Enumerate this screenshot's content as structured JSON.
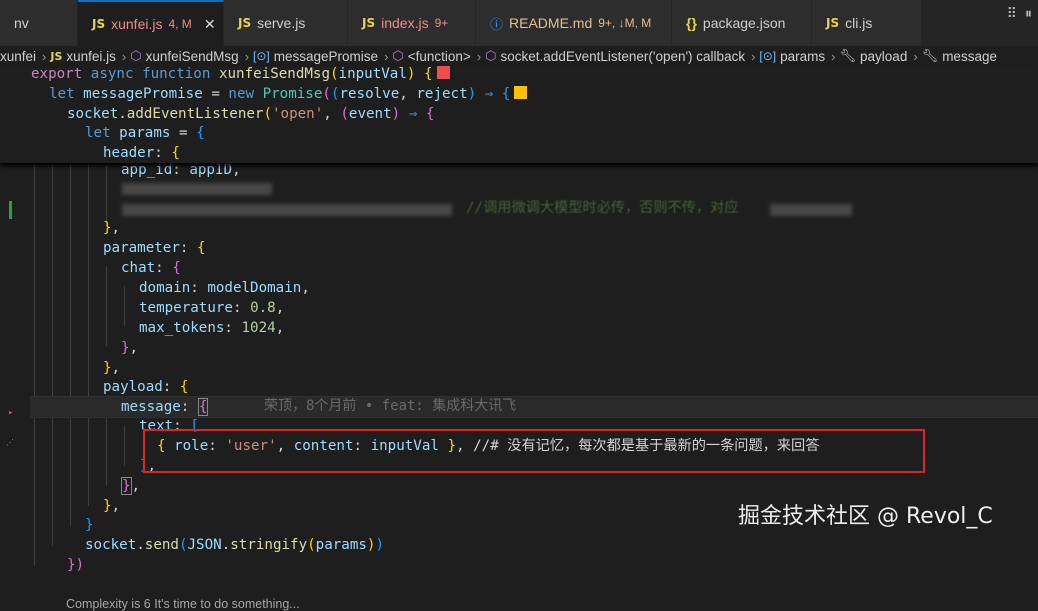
{
  "tabs": [
    {
      "icon": "",
      "label": "nv",
      "badge": "",
      "active": false
    },
    {
      "icon": "JS",
      "label": "xunfei.js",
      "badge": "4, M",
      "active": true
    },
    {
      "icon": "JS",
      "label": "serve.js",
      "badge": "",
      "active": false
    },
    {
      "icon": "JS",
      "label": "index.js",
      "badge": "9+",
      "active": false
    },
    {
      "icon": "ⓘ",
      "label": "README.md",
      "badge": "9+, ↓M, M",
      "active": false
    },
    {
      "icon": "{}",
      "label": "package.json",
      "badge": "",
      "active": false
    },
    {
      "icon": "JS",
      "label": "cli.js",
      "badge": "",
      "active": false
    }
  ],
  "breadcrumb": {
    "folder": "xunfei",
    "file": "xunfei.js",
    "fn": "xunfeiSendMsg",
    "var1": "messagePromise",
    "anon": "<function>",
    "callback": "socket.addEventListener('open') callback",
    "params": "params",
    "payload": "payload",
    "message": "message"
  },
  "code": {
    "l1": {
      "export": "export",
      "async": "async",
      "function": "function",
      "name": "xunfeiSendMsg",
      "arg": "inputVal"
    },
    "l2": {
      "let": "let",
      "name": "messagePromise",
      "new": "new",
      "cls": "Promise",
      "a": "resolve",
      "b": "reject"
    },
    "l3": {
      "obj": "socket",
      "method": "addEventListener",
      "str": "'open'",
      "arg": "event"
    },
    "l4": {
      "let": "let",
      "name": "params"
    },
    "l5": {
      "key": "header"
    },
    "l6": {
      "key": "app_id",
      "val": "appID"
    },
    "l7_comment": "//调用微调大模型时必传，否则不传，对应",
    "l9": {
      "key": "parameter"
    },
    "l10": {
      "key": "chat"
    },
    "l11": {
      "key": "domain",
      "val": "modelDomain"
    },
    "l12": {
      "key": "temperature",
      "val": "0.8"
    },
    "l13": {
      "key": "max_tokens",
      "val": "1024"
    },
    "l16": {
      "key": "payload"
    },
    "l17": {
      "key": "message"
    },
    "l18": {
      "key": "text"
    },
    "l19": {
      "k1": "role",
      "v1": "'user'",
      "k2": "content",
      "v2": "inputVal",
      "comment": "//# 没有记忆，每次都是基于最新的一条问题，来回答"
    },
    "l24": {
      "obj": "socket",
      "method": "send",
      "cls": "JSON",
      "fn": "stringify",
      "arg": "params"
    }
  },
  "blame": "荣顶，8个月前 • feat: 集成科大讯飞",
  "codelens": "Complexity is 6 It's time to do something...",
  "watermark": "掘金技术社区 @ Revol_C",
  "colors": {
    "accent_red": "#d9262a",
    "box_red": "#f14c4c",
    "box_yellow": "#ffc107"
  }
}
